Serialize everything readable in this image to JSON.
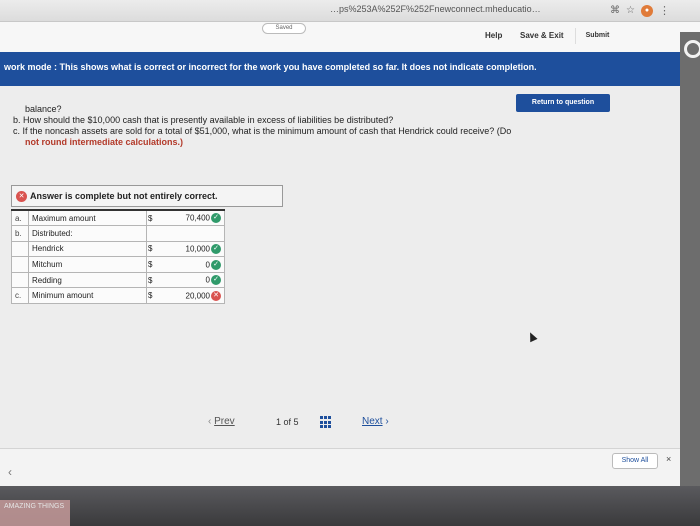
{
  "browser": {
    "url": "…ps%253A%252F%252Fnewconnect.mheducatio…",
    "icons": [
      "command-icon",
      "star-icon",
      "profile-icon",
      "menu-dots-icon"
    ]
  },
  "header": {
    "saved_label": "Saved",
    "help_label": "Help",
    "save_exit_label": "Save & Exit",
    "submit_label": "Submit"
  },
  "banner": {
    "text": "work mode : This shows what is correct or incorrect for the work you have completed so far. It does not indicate completion."
  },
  "content": {
    "return_label": "Return to question",
    "question": {
      "line1": "balance?",
      "line2": "b. How should the $10,000 cash that is presently available in excess of liabilities be distributed?",
      "line3": "c. If the noncash assets are sold for a total of $51,000, what is the minimum amount of cash that Hendrick could receive? (Do",
      "line4": "not round intermediate calculations.)"
    },
    "answer_status": "Answer is complete but not entirely correct.",
    "table": {
      "rows": [
        {
          "letter": "a.",
          "label": "Maximum amount",
          "currency": "$",
          "value": "70,400",
          "mark": "correct"
        },
        {
          "letter": "b.",
          "label": "Distributed:",
          "currency": "",
          "value": "",
          "mark": ""
        },
        {
          "letter": "",
          "label": "Hendrick",
          "currency": "$",
          "value": "10,000",
          "mark": "correct"
        },
        {
          "letter": "",
          "label": "Mitchum",
          "currency": "$",
          "value": "0",
          "mark": "correct"
        },
        {
          "letter": "",
          "label": "Redding",
          "currency": "$",
          "value": "0",
          "mark": "correct"
        },
        {
          "letter": "c.",
          "label": "Minimum amount",
          "currency": "$",
          "value": "20,000",
          "mark": "incorrect"
        }
      ]
    }
  },
  "pager": {
    "prev_label": "Prev",
    "page_of": "1 of 5",
    "next_label": "Next"
  },
  "footer": {
    "show_all_label": "Show All",
    "close_glyph": "×"
  },
  "sticker": {
    "text": "AMAZING THINGS"
  }
}
